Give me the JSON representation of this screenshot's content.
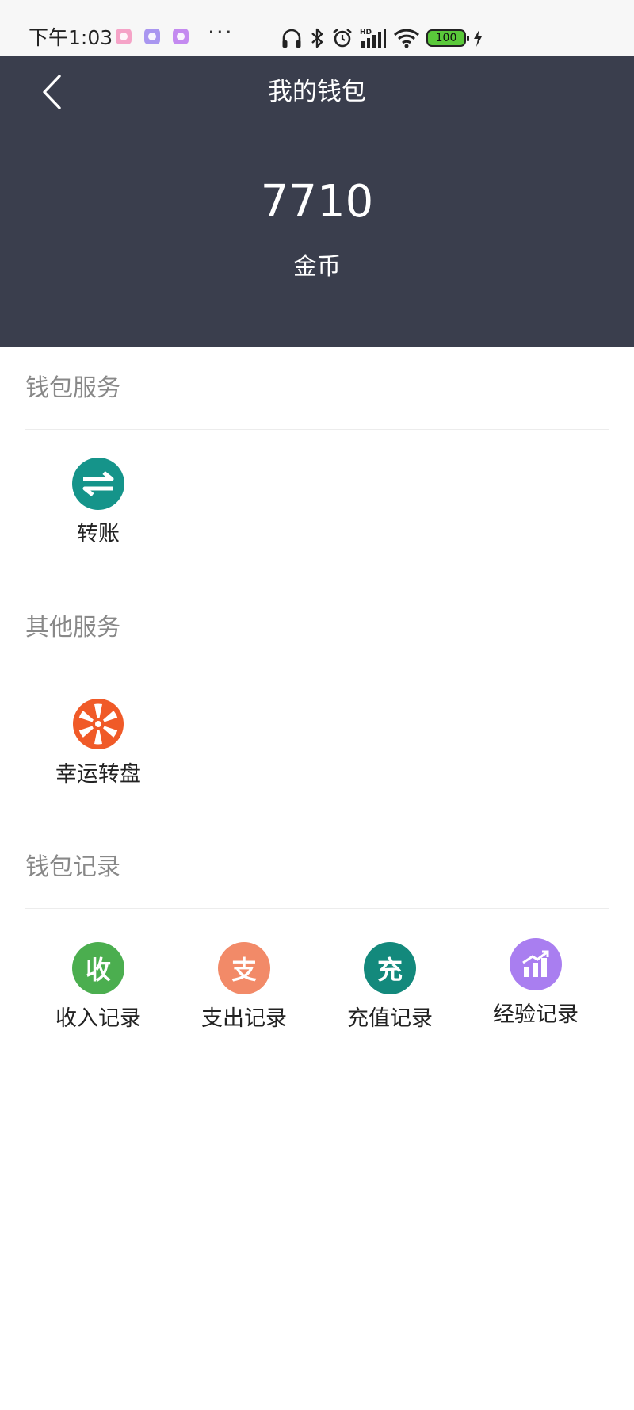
{
  "status_bar": {
    "time": "下午1:03",
    "more": "···",
    "battery": "100",
    "app_dot_colors": [
      "#f5a3c7",
      "#a996f0",
      "#c48af0"
    ]
  },
  "header": {
    "title": "我的钱包",
    "balance": "7710",
    "unit": "金币",
    "background": "#3a3e4d"
  },
  "sections": {
    "wallet_services": {
      "title": "钱包服务",
      "items": [
        {
          "label": "转账",
          "icon": "transfer-icon",
          "color": "#15948a"
        }
      ]
    },
    "other_services": {
      "title": "其他服务",
      "items": [
        {
          "label": "幸运转盘",
          "icon": "lucky-wheel-icon",
          "color": "#f05a28"
        }
      ]
    },
    "wallet_records": {
      "title": "钱包记录",
      "items": [
        {
          "label": "收入记录",
          "glyph": "收",
          "icon": "income-icon",
          "color": "#4bae4f"
        },
        {
          "label": "支出记录",
          "glyph": "支",
          "icon": "expense-icon",
          "color": "#f28a68"
        },
        {
          "label": "充值记录",
          "glyph": "充",
          "icon": "recharge-icon",
          "color": "#13897c"
        },
        {
          "label": "经验记录",
          "icon": "bar-chart-icon",
          "color": "#a97ef0"
        }
      ]
    }
  }
}
